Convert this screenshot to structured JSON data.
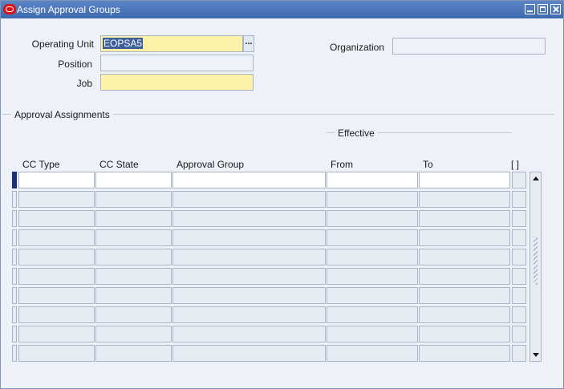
{
  "window": {
    "title": "Assign Approval Groups",
    "logo": "oracle-logo"
  },
  "header_form": {
    "operating_unit_label": "Operating Unit",
    "operating_unit_value": "EOPSA5",
    "lov_button_label": "...",
    "position_label": "Position",
    "position_value": "",
    "job_label": "Job",
    "job_value": "",
    "organization_label": "Organization",
    "organization_value": ""
  },
  "section": {
    "title": "Approval Assignments",
    "effective_label": "Effective"
  },
  "table": {
    "columns": [
      "CC Type",
      "CC State",
      "Approval Group",
      "From",
      "To",
      "[ ]"
    ],
    "row_count": 10,
    "rows": [
      [
        "",
        "",
        "",
        "",
        ""
      ],
      [
        "",
        "",
        "",
        "",
        ""
      ],
      [
        "",
        "",
        "",
        "",
        ""
      ],
      [
        "",
        "",
        "",
        "",
        ""
      ],
      [
        "",
        "",
        "",
        "",
        ""
      ],
      [
        "",
        "",
        "",
        "",
        ""
      ],
      [
        "",
        "",
        "",
        "",
        ""
      ],
      [
        "",
        "",
        "",
        "",
        ""
      ],
      [
        "",
        "",
        "",
        "",
        ""
      ],
      [
        "",
        "",
        "",
        "",
        ""
      ]
    ]
  },
  "colors": {
    "title_bar": "#3d69ae",
    "required_field": "#fdf1a8",
    "window_background": "#eef1f7",
    "selection": "#3f5f9a"
  }
}
